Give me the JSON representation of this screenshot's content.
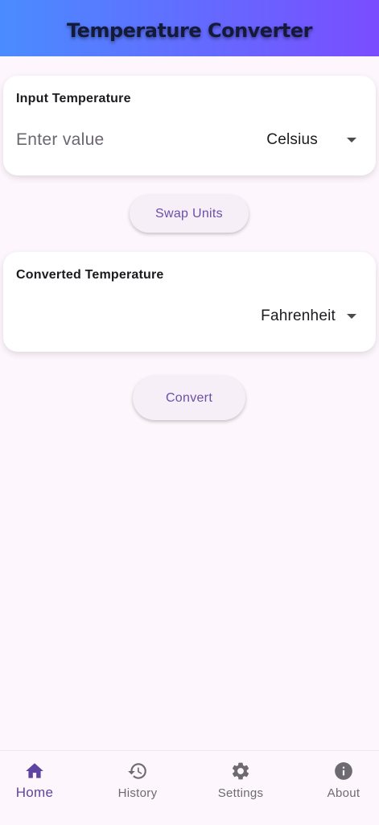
{
  "app_bar": {
    "title": "Temperature Converter"
  },
  "input_card": {
    "label": "Input Temperature",
    "input_value": "",
    "input_placeholder": "Enter value",
    "unit": "Celsius"
  },
  "swap_button": {
    "label": "Swap Units"
  },
  "output_card": {
    "label": "Converted Temperature",
    "value": "",
    "unit": "Fahrenheit"
  },
  "convert_button": {
    "label": "Convert"
  },
  "bottom_nav": {
    "items": [
      {
        "label": "Home",
        "icon": "home-icon",
        "active": true
      },
      {
        "label": "History",
        "icon": "history-icon",
        "active": false
      },
      {
        "label": "Settings",
        "icon": "gear-icon",
        "active": false
      },
      {
        "label": "About",
        "icon": "info-icon",
        "active": false
      }
    ]
  },
  "colors": {
    "app_bar_gradient_start": "#4a8cff",
    "app_bar_gradient_end": "#7a4dff",
    "background": "#fdf6fc",
    "accent": "#5e43a3",
    "button_text": "#6a4fa8"
  }
}
